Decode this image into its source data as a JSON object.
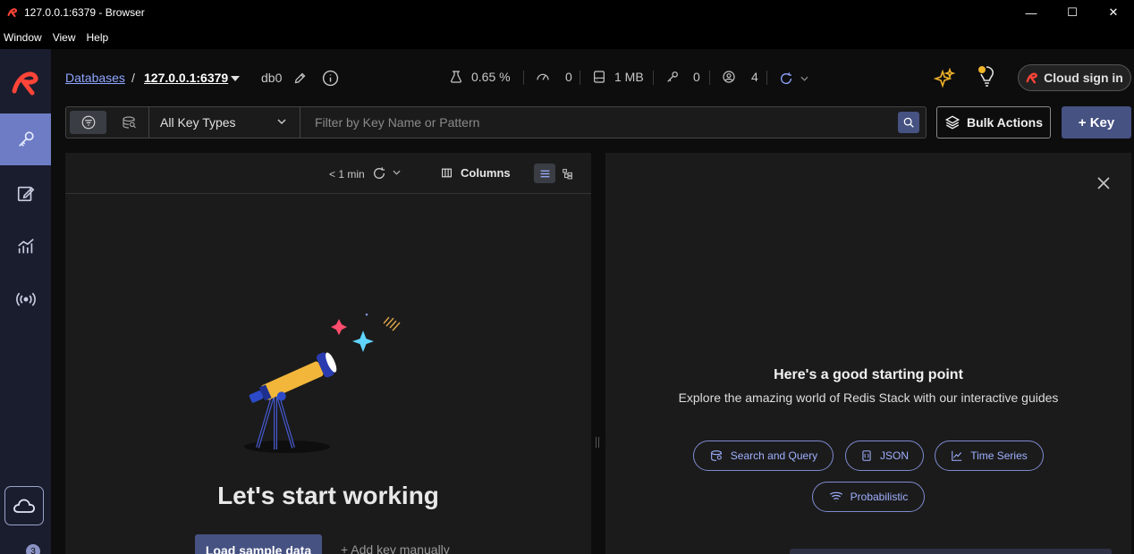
{
  "window": {
    "title": "127.0.0.1:6379 - Browser",
    "menu": [
      "Window",
      "View",
      "Help"
    ],
    "controls": {
      "minimize": "—",
      "maximize": "☐",
      "close": "✕"
    }
  },
  "colors": {
    "accent": "#465282",
    "brand_red": "#ff4438",
    "link": "#8fa6ff",
    "nav_bg": "#1a1d2e",
    "active_nav": "#6d7cc4"
  },
  "nav": {
    "items": [
      {
        "name": "browser",
        "icon": "key-icon"
      },
      {
        "name": "workbench",
        "icon": "edit-icon"
      },
      {
        "name": "analysis",
        "icon": "chart-icon"
      },
      {
        "name": "pubsub",
        "icon": "broadcast-icon"
      }
    ],
    "cloud_icon": "cloud-icon",
    "notification_count": "3"
  },
  "header": {
    "breadcrumb_root": "Databases",
    "separator": "/",
    "db_address": "127.0.0.1:6379",
    "db_index": "db0",
    "stats": {
      "cpu": "0.65 %",
      "ops": "0",
      "memory": "1 MB",
      "keys": "0",
      "clients": "4"
    },
    "cloud_signin": "Cloud sign in"
  },
  "filter": {
    "key_type": "All Key Types",
    "search_placeholder": "Filter by Key Name or Pattern",
    "bulk_actions": "Bulk Actions",
    "add_key": "+ Key"
  },
  "key_list": {
    "last_refresh": "< 1 min",
    "columns_label": "Columns",
    "empty_title": "Let's start working",
    "load_sample": "Load sample data",
    "add_manually": "+ Add key manually"
  },
  "guides": {
    "title": "Here's a good starting point",
    "subtitle": "Explore the amazing world of Redis Stack with our interactive guides",
    "buttons": [
      "Search and Query",
      "JSON",
      "Time Series",
      "Probabilistic"
    ]
  }
}
